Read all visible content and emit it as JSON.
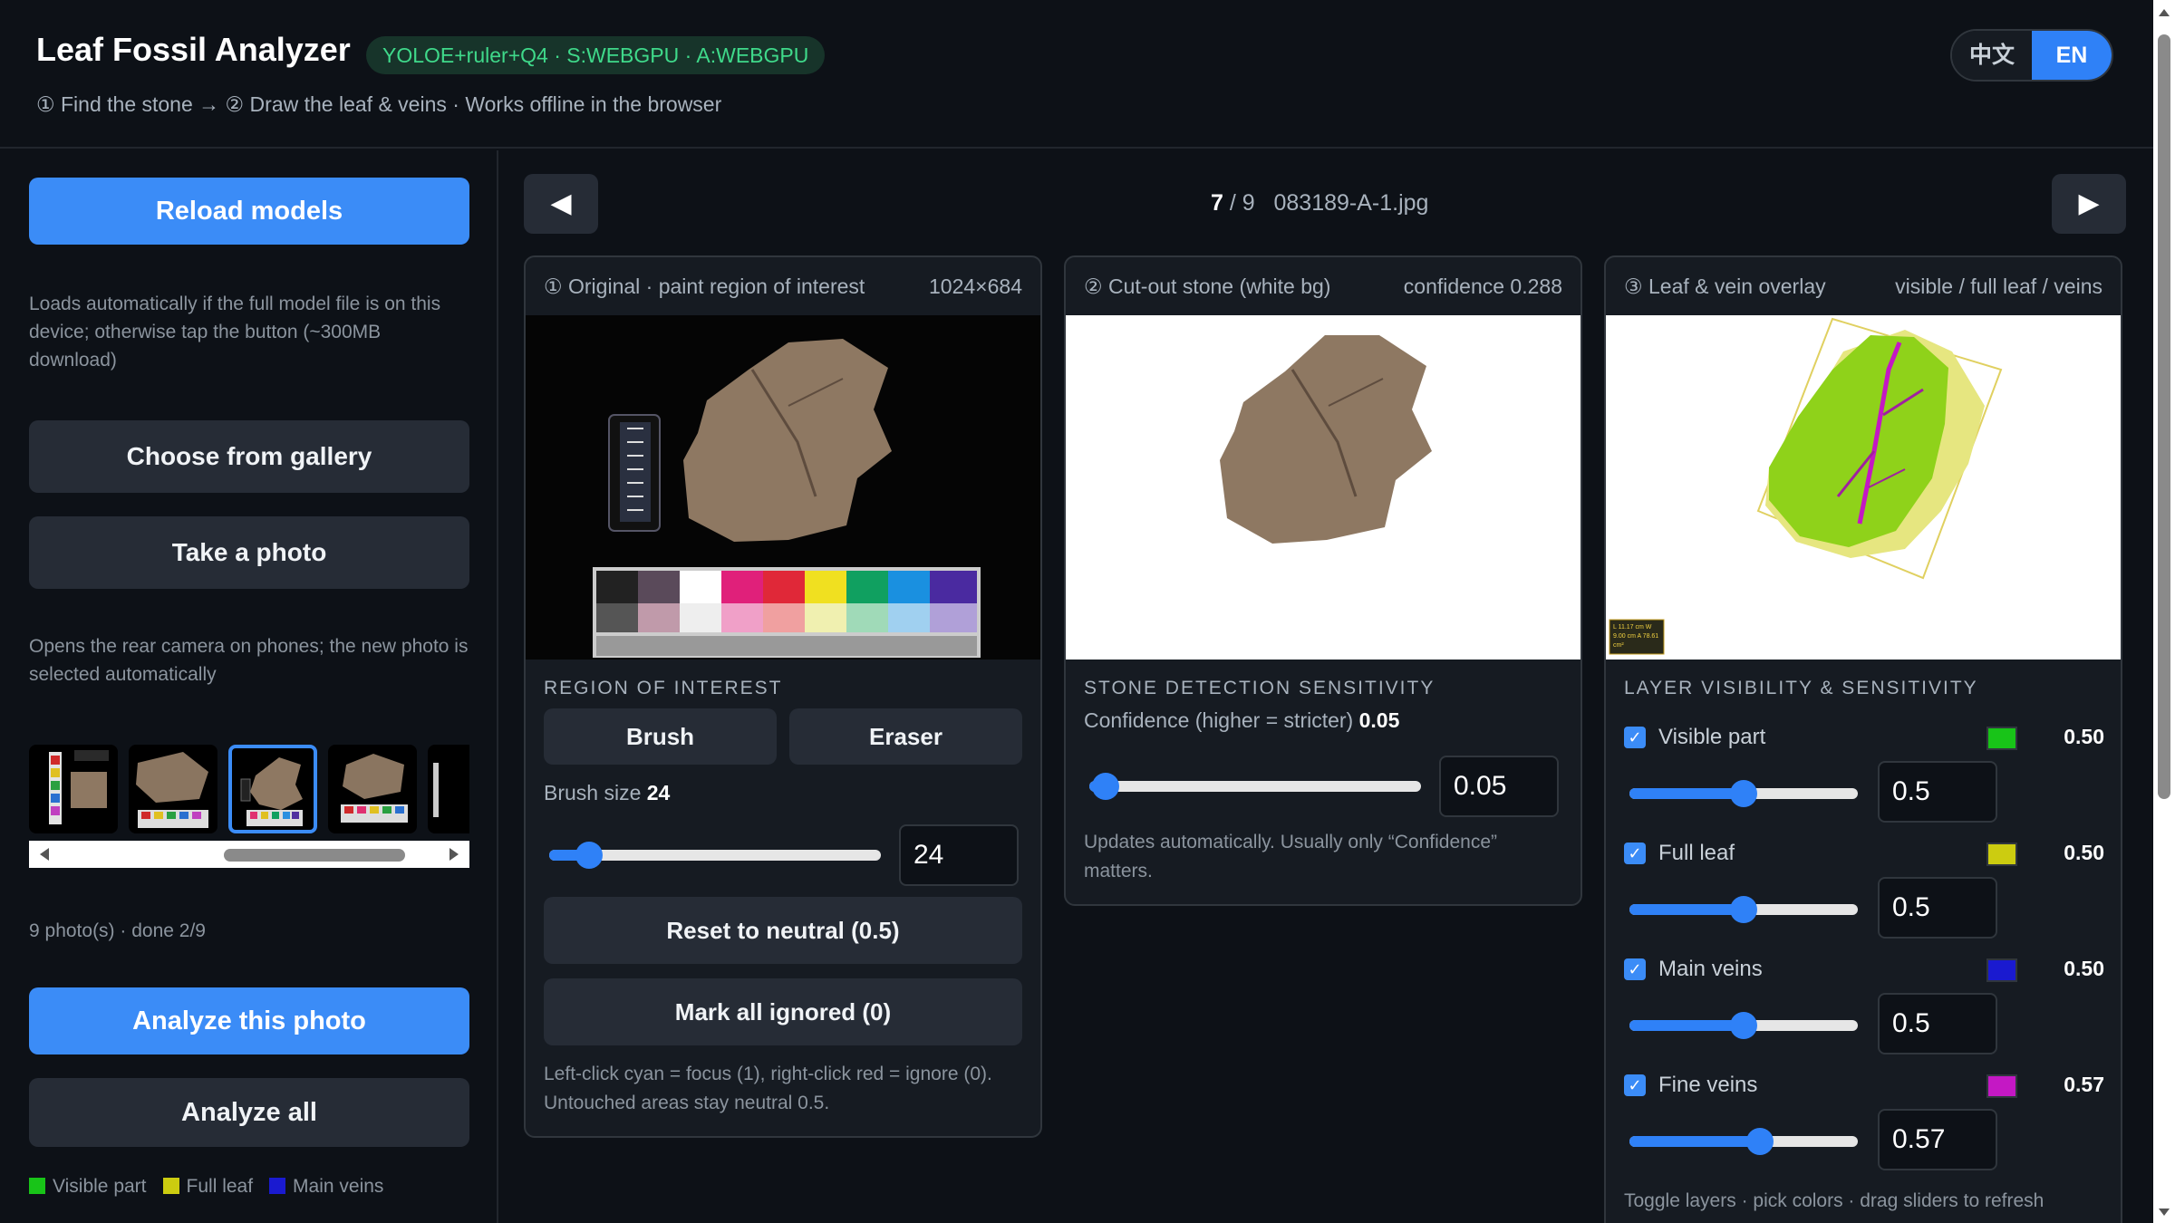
{
  "header": {
    "title": "Leaf Fossil Analyzer",
    "badge": "YOLOE+ruler+Q4 · S:WEBGPU · A:WEBGPU",
    "subtitle": "① Find the stone → ② Draw the leaf & veins · Works offline in the browser",
    "lang_zh": "中文",
    "lang_en": "EN"
  },
  "sidebar": {
    "reload": "Reload models",
    "reload_note": "Loads automatically if the full model file is on this device; otherwise tap the button (~300MB download)",
    "gallery": "Choose from gallery",
    "photo": "Take a photo",
    "photo_note": "Opens the rear camera on phones; the new photo is selected automatically",
    "count": "9 photo(s) · done 2/9",
    "analyze_this": "Analyze this photo",
    "analyze_all": "Analyze all",
    "legend": [
      {
        "label": "Visible part",
        "color": "#18c418"
      },
      {
        "label": "Full leaf",
        "color": "#cccc10"
      },
      {
        "label": "Main veins",
        "color": "#1a1ad0"
      }
    ]
  },
  "nav": {
    "prev": "◀",
    "next": "▶",
    "current": "7",
    "total": "/ 9",
    "filename": "083189-A-1.jpg"
  },
  "panel1": {
    "title": "① Original · paint region of interest",
    "size": "1024×684",
    "section": "REGION OF INTEREST",
    "brush": "Brush",
    "eraser": "Eraser",
    "brush_size_label": "Brush size",
    "brush_size": "24",
    "brush_fraction": 0.12,
    "reset": "Reset to neutral (0.5)",
    "mark": "Mark all ignored (0)",
    "note": "Left-click cyan = focus (1), right-click red = ignore (0). Untouched areas stay neutral 0.5."
  },
  "panel2": {
    "title": "② Cut-out stone (white bg)",
    "confidence": "confidence 0.288",
    "section": "STONE DETECTION SENSITIVITY",
    "conf_label": "Confidence (higher = stricter)",
    "conf_value": "0.05",
    "conf_fraction": 0.05,
    "note": "Updates automatically. Usually only “Confidence” matters."
  },
  "panel3": {
    "title": "③ Leaf & vein overlay",
    "legend": "visible / full leaf / veins",
    "section": "LAYER VISIBILITY & SENSITIVITY",
    "layers": [
      {
        "label": "Visible part",
        "color": "#18c418",
        "value": "0.50",
        "input": "0.5",
        "fraction": 0.5
      },
      {
        "label": "Full leaf",
        "color": "#cccc10",
        "value": "0.50",
        "input": "0.5",
        "fraction": 0.5
      },
      {
        "label": "Main veins",
        "color": "#1a1ad0",
        "value": "0.50",
        "input": "0.5",
        "fraction": 0.5
      },
      {
        "label": "Fine veins",
        "color": "#c418c4",
        "value": "0.57",
        "input": "0.57",
        "fraction": 0.57
      }
    ],
    "ruler_label": "L 11.17 cm W 9.00 cm A 78.61 cm²",
    "footer": "Toggle layers · pick colors · drag sliders to refresh"
  }
}
